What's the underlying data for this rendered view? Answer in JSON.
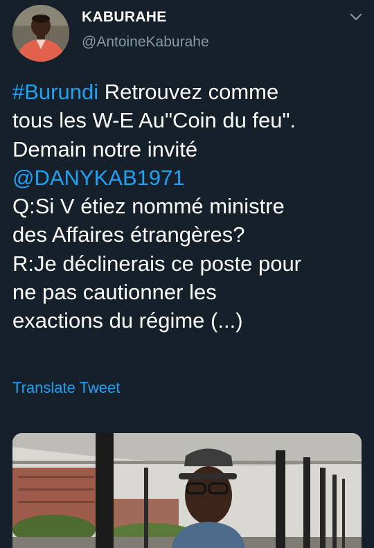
{
  "author": {
    "display_name": "KABURAHE",
    "handle": "@AntoineKaburahe"
  },
  "tweet": {
    "lines": [
      [
        {
          "text": "#Burundi",
          "link": true
        },
        {
          "text": " Retrouvez comme",
          "link": false
        }
      ],
      [
        {
          "text": "tous les W-E Au\"Coin du feu\".",
          "link": false
        }
      ],
      [
        {
          "text": "Demain notre invité",
          "link": false
        }
      ],
      [
        {
          "text": "@DANYKAB1971",
          "link": true
        }
      ],
      [
        {
          "text": "Q:Si V étiez nommé ministre",
          "link": false
        }
      ],
      [
        {
          "text": "des Affaires étrangères?",
          "link": false
        }
      ],
      [
        {
          "text": "R:Je déclinerais ce poste pour",
          "link": false
        }
      ],
      [
        {
          "text": "ne pas cautionner les",
          "link": false
        }
      ],
      [
        {
          "text": "exactions du régime (...)",
          "link": false
        }
      ]
    ]
  },
  "translate_label": "Translate Tweet",
  "icons": {
    "menu": "chevron-down-icon"
  },
  "colors": {
    "background": "#15202b",
    "text": "#ffffff",
    "secondary_text": "#8899a6",
    "link": "#1da1f2"
  }
}
